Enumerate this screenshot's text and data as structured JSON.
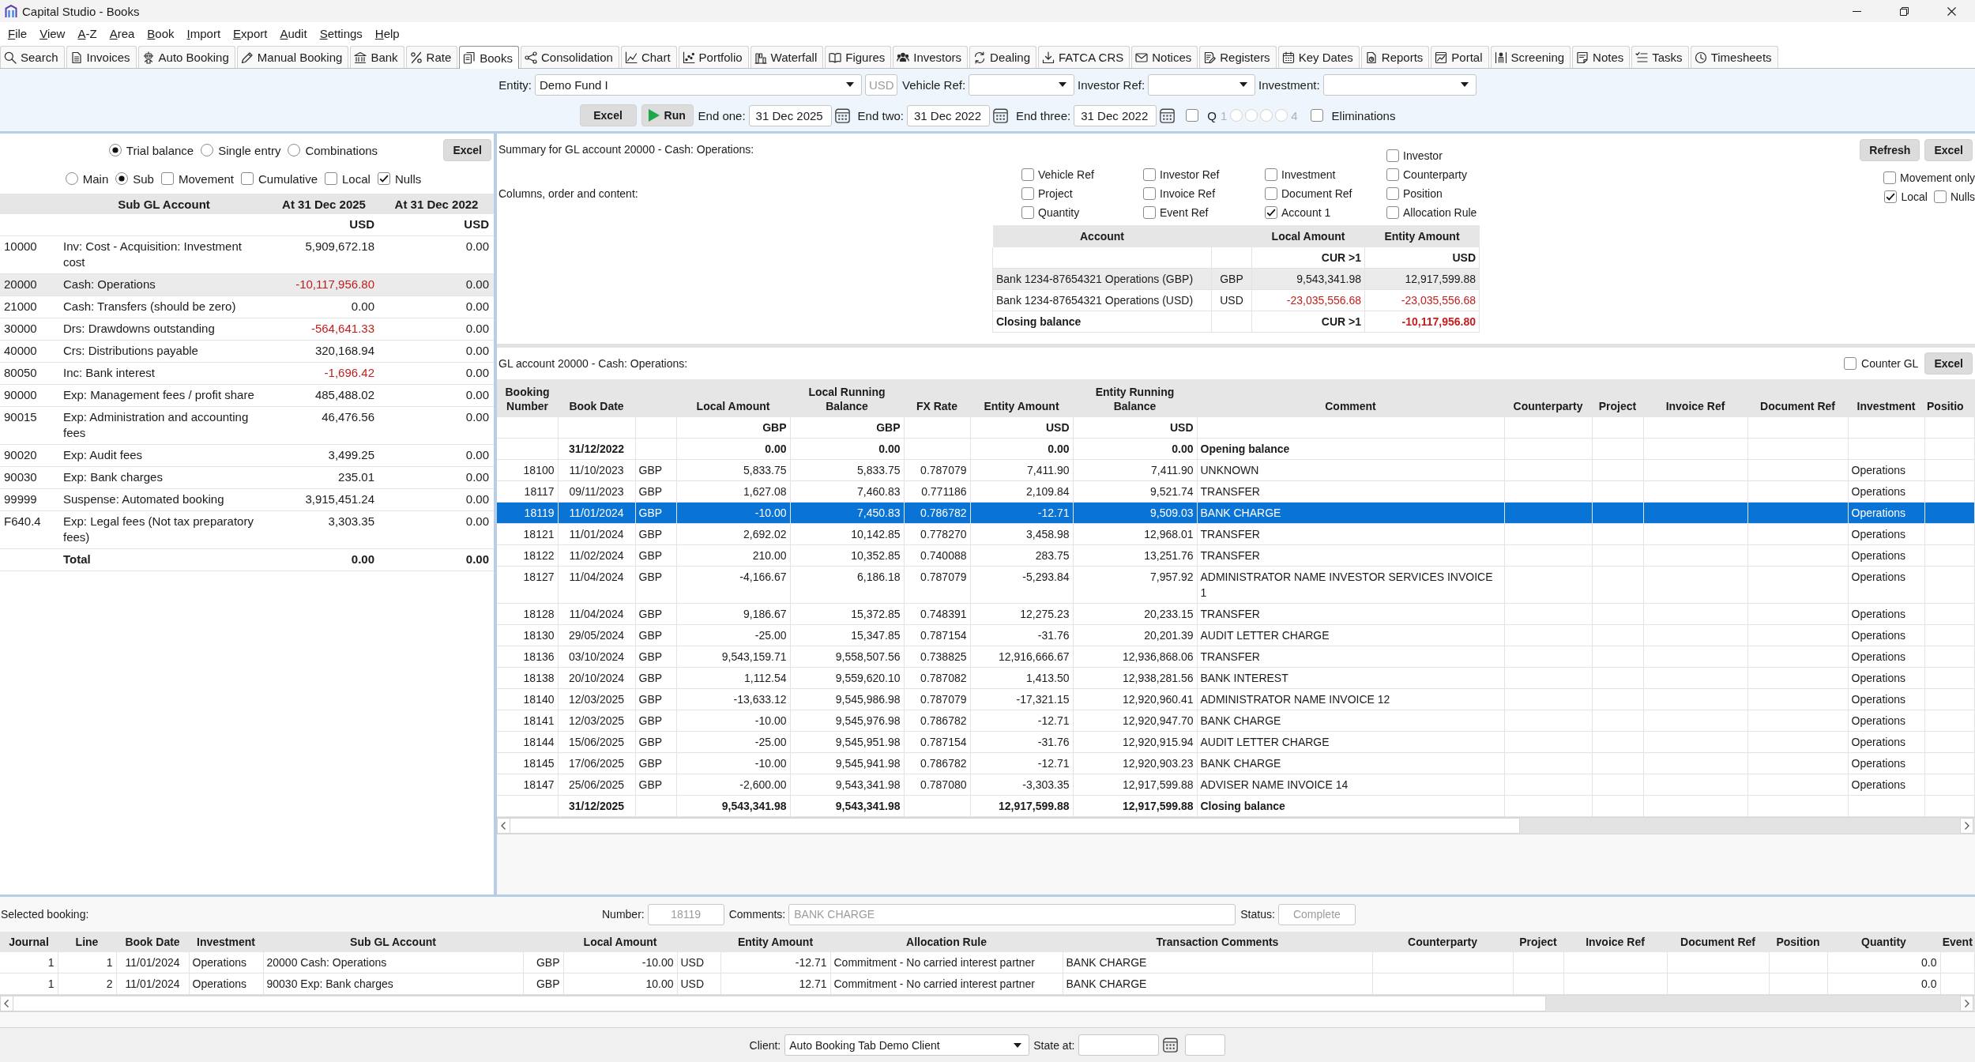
{
  "window": {
    "title": "Capital Studio - Books"
  },
  "menu": [
    "File",
    "View",
    "A-Z",
    "Area",
    "Book",
    "Import",
    "Export",
    "Audit",
    "Settings",
    "Help"
  ],
  "toolbar": [
    {
      "label": "Search",
      "selected": false
    },
    {
      "label": "Invoices",
      "selected": false
    },
    {
      "label": "Auto Booking",
      "selected": false
    },
    {
      "label": "Manual Booking",
      "selected": false
    },
    {
      "label": "Bank",
      "selected": false
    },
    {
      "label": "Rate",
      "selected": false
    },
    {
      "label": "Books",
      "selected": true
    },
    {
      "label": "Consolidation",
      "selected": false
    },
    {
      "label": "Chart",
      "selected": false
    },
    {
      "label": "Portfolio",
      "selected": false
    },
    {
      "label": "Waterfall",
      "selected": false
    },
    {
      "label": "Figures",
      "selected": false
    },
    {
      "label": "Investors",
      "selected": false
    },
    {
      "label": "Dealing",
      "selected": false
    },
    {
      "label": "FATCA CRS",
      "selected": false
    },
    {
      "label": "Notices",
      "selected": false
    },
    {
      "label": "Registers",
      "selected": false
    },
    {
      "label": "Key Dates",
      "selected": false
    },
    {
      "label": "Reports",
      "selected": false
    },
    {
      "label": "Portal",
      "selected": false
    },
    {
      "label": "Screening",
      "selected": false
    },
    {
      "label": "Notes",
      "selected": false
    },
    {
      "label": "Tasks",
      "selected": false
    },
    {
      "label": "Timesheets",
      "selected": false
    }
  ],
  "filters": {
    "entity": {
      "label": "Entity:",
      "value": "Demo Fund I"
    },
    "currency": {
      "value": "USD",
      "disabled": true
    },
    "vehicle_ref": {
      "label": "Vehicle Ref:"
    },
    "investor_ref": {
      "label": "Investor Ref:"
    },
    "investment": {
      "label": "Investment:"
    }
  },
  "run_bar": {
    "excel": "Excel",
    "run": "Run",
    "dates": [
      {
        "label": "End one:",
        "value": "31 Dec 2025"
      },
      {
        "label": "End two:",
        "value": "31 Dec 2022"
      },
      {
        "label": "End three:",
        "value": "31 Dec 2022"
      }
    ],
    "quarter": {
      "label": "Q",
      "checked": false,
      "disabled": true,
      "range_start": "1",
      "range_end": "4",
      "options": [
        {
          "selected": false
        },
        {
          "selected": false
        },
        {
          "selected": false
        },
        {
          "selected": false
        }
      ]
    },
    "eliminations": {
      "label": "Eliminations",
      "checked": false
    }
  },
  "trial_balance": {
    "modes": [
      {
        "label": "Trial balance",
        "selected": true
      },
      {
        "label": "Single entry",
        "selected": false
      },
      {
        "label": "Combinations",
        "selected": false
      }
    ],
    "excel": "Excel",
    "levels": [
      {
        "label": "Main",
        "selected": false
      },
      {
        "label": "Sub",
        "selected": true
      }
    ],
    "options": [
      {
        "label": "Movement",
        "checked": false
      },
      {
        "label": "Cumulative",
        "checked": false
      },
      {
        "label": "Local",
        "checked": false
      },
      {
        "label": "Nulls",
        "checked": true
      }
    ],
    "table": {
      "columns": {
        "account": "Sub GL Account",
        "end_one": "At 31 Dec 2025",
        "end_two": "At 31 Dec 2022"
      },
      "units": {
        "end_one": "USD",
        "end_two": "USD"
      },
      "rows": [
        {
          "code": "10000",
          "account": "Inv: Cost - Acquisition: Investment cost",
          "end_one": "5,909,672.18",
          "end_two": "0.00",
          "selected": false
        },
        {
          "code": "20000",
          "account": "Cash: Operations",
          "end_one": "-10,117,956.80",
          "end_two": "0.00",
          "selected": true
        },
        {
          "code": "21000",
          "account": "Cash: Transfers (should be zero)",
          "end_one": "0.00",
          "end_two": "0.00",
          "selected": false
        },
        {
          "code": "30000",
          "account": "Drs: Drawdowns outstanding",
          "end_one": "-564,641.33",
          "end_two": "0.00",
          "selected": false
        },
        {
          "code": "40000",
          "account": "Crs: Distributions payable",
          "end_one": "320,168.94",
          "end_two": "0.00",
          "selected": false
        },
        {
          "code": "80050",
          "account": "Inc: Bank interest",
          "end_one": "-1,696.42",
          "end_two": "0.00",
          "selected": false
        },
        {
          "code": "90000",
          "account": "Exp: Management fees / profit share",
          "end_one": "485,488.02",
          "end_two": "0.00",
          "selected": false
        },
        {
          "code": "90015",
          "account": "Exp: Administration and accounting fees",
          "end_one": "46,476.56",
          "end_two": "0.00",
          "selected": false
        },
        {
          "code": "90020",
          "account": "Exp: Audit fees",
          "end_one": "3,499.25",
          "end_two": "0.00",
          "selected": false
        },
        {
          "code": "90030",
          "account": "Exp: Bank charges",
          "end_one": "235.01",
          "end_two": "0.00",
          "selected": false
        },
        {
          "code": "99999",
          "account": "Suspense: Automated booking",
          "end_one": "3,915,451.24",
          "end_two": "0.00",
          "selected": false
        },
        {
          "code": "F640.4",
          "account": "Exp: Legal fees (Not tax preparatory fees)",
          "end_one": "3,303.35",
          "end_two": "0.00",
          "selected": false
        }
      ],
      "total": {
        "account": "Total",
        "end_one": "0.00",
        "end_two": "0.00"
      }
    }
  },
  "summary": {
    "title": "Summary for GL account 20000 - Cash: Operations:",
    "columns_label": "Columns, order and content:",
    "column_groups": [
      {
        "options": [
          {
            "label": "Vehicle Ref",
            "checked": false
          },
          {
            "label": "Project",
            "checked": false
          },
          {
            "label": "Quantity",
            "checked": false
          }
        ]
      },
      {
        "options": [
          {
            "label": "Investor Ref",
            "checked": false
          },
          {
            "label": "Invoice Ref",
            "checked": false
          },
          {
            "label": "Event Ref",
            "checked": false
          }
        ]
      },
      {
        "options": [
          {
            "label": "Investment",
            "checked": false
          },
          {
            "label": "Document Ref",
            "checked": false
          },
          {
            "label": "Account 1",
            "checked": true
          }
        ]
      },
      {
        "options": [
          {
            "label": "Investor",
            "checked": false
          },
          {
            "label": "Counterparty",
            "checked": false
          },
          {
            "label": "Position",
            "checked": false
          },
          {
            "label": "Allocation Rule",
            "checked": false
          }
        ]
      }
    ],
    "refresh": "Refresh",
    "excel": "Excel",
    "options": [
      {
        "label": "Movement only",
        "checked": false
      },
      {
        "label": "Local",
        "checked": true
      },
      {
        "label": "Nulls",
        "checked": false
      }
    ],
    "table": {
      "columns": {
        "account": "Account",
        "local_amount": "Local Amount",
        "entity_amount": "Entity Amount"
      },
      "units": {
        "local_amount": "CUR >1",
        "entity_amount": "USD"
      },
      "rows": [
        {
          "account": "Bank 1234-87654321 Operations (GBP)",
          "currency": "GBP",
          "local_amount": "9,543,341.98",
          "entity_amount": "12,917,599.88",
          "selected": true
        },
        {
          "account": "Bank 1234-87654321 Operations (USD)",
          "currency": "USD",
          "local_amount": "-23,035,556.68",
          "entity_amount": "-23,035,556.68",
          "selected": false
        }
      ],
      "closing": {
        "account": "Closing balance",
        "local_amount": "CUR >1",
        "entity_amount": "-10,117,956.80"
      }
    }
  },
  "gl_detail": {
    "title": "GL account 20000 - Cash: Operations:",
    "counter_gl": {
      "label": "Counter GL",
      "checked": false
    },
    "excel": "Excel",
    "table": {
      "columns": {
        "booking_number": "Booking Number",
        "book_date": "Book Date",
        "local_amount": "Local Amount",
        "local_running_balance": "Local Running Balance",
        "fx_rate": "FX Rate",
        "entity_amount": "Entity Amount",
        "entity_running_balance": "Entity Running Balance",
        "comment": "Comment",
        "counterparty": "Counterparty",
        "project": "Project",
        "invoice_ref": "Invoice Ref",
        "document_ref": "Document Ref",
        "investment": "Investment",
        "position": "Positio"
      },
      "units": {
        "local_amount": "GBP",
        "local_running_balance": "GBP",
        "entity_amount": "USD",
        "entity_running_balance": "USD"
      },
      "opening": {
        "book_date": "31/12/2022",
        "local_amount": "0.00",
        "local_running_balance": "0.00",
        "entity_amount": "0.00",
        "entity_running_balance": "0.00",
        "comment": "Opening balance"
      },
      "rows": [
        {
          "booking_number": "18100",
          "book_date": "11/10/2023",
          "currency": "GBP",
          "local_amount": "5,833.75",
          "local_running_balance": "5,833.75",
          "fx_rate": "0.787079",
          "entity_amount": "7,411.90",
          "entity_running_balance": "7,411.90",
          "comment": "UNKNOWN",
          "investment": "Operations",
          "selected": false
        },
        {
          "booking_number": "18117",
          "book_date": "09/11/2023",
          "currency": "GBP",
          "local_amount": "1,627.08",
          "local_running_balance": "7,460.83",
          "fx_rate": "0.771186",
          "entity_amount": "2,109.84",
          "entity_running_balance": "9,521.74",
          "comment": "TRANSFER",
          "investment": "Operations",
          "selected": false
        },
        {
          "booking_number": "18119",
          "book_date": "11/01/2024",
          "currency": "GBP",
          "local_amount": "-10.00",
          "local_running_balance": "7,450.83",
          "fx_rate": "0.786782",
          "entity_amount": "-12.71",
          "entity_running_balance": "9,509.03",
          "comment": "BANK CHARGE",
          "investment": "Operations",
          "selected": true
        },
        {
          "booking_number": "18121",
          "book_date": "11/01/2024",
          "currency": "GBP",
          "local_amount": "2,692.02",
          "local_running_balance": "10,142.85",
          "fx_rate": "0.778270",
          "entity_amount": "3,458.98",
          "entity_running_balance": "12,968.01",
          "comment": "TRANSFER",
          "investment": "Operations",
          "selected": false
        },
        {
          "booking_number": "18122",
          "book_date": "11/02/2024",
          "currency": "GBP",
          "local_amount": "210.00",
          "local_running_balance": "10,352.85",
          "fx_rate": "0.740088",
          "entity_amount": "283.75",
          "entity_running_balance": "13,251.76",
          "comment": "TRANSFER",
          "investment": "Operations",
          "selected": false
        },
        {
          "booking_number": "18127",
          "book_date": "11/04/2024",
          "currency": "GBP",
          "local_amount": "-4,166.67",
          "local_running_balance": "6,186.18",
          "fx_rate": "0.787079",
          "entity_amount": "-5,293.84",
          "entity_running_balance": "7,957.92",
          "comment": "ADMINISTRATOR NAME INVESTOR SERVICES INVOICE 1",
          "investment": "Operations",
          "selected": false
        },
        {
          "booking_number": "18128",
          "book_date": "11/04/2024",
          "currency": "GBP",
          "local_amount": "9,186.67",
          "local_running_balance": "15,372.85",
          "fx_rate": "0.748391",
          "entity_amount": "12,275.23",
          "entity_running_balance": "20,233.15",
          "comment": "TRANSFER",
          "investment": "Operations",
          "selected": false
        },
        {
          "booking_number": "18130",
          "book_date": "29/05/2024",
          "currency": "GBP",
          "local_amount": "-25.00",
          "local_running_balance": "15,347.85",
          "fx_rate": "0.787154",
          "entity_amount": "-31.76",
          "entity_running_balance": "20,201.39",
          "comment": "AUDIT LETTER CHARGE",
          "investment": "Operations",
          "selected": false
        },
        {
          "booking_number": "18136",
          "book_date": "03/10/2024",
          "currency": "GBP",
          "local_amount": "9,543,159.71",
          "local_running_balance": "9,558,507.56",
          "fx_rate": "0.738825",
          "entity_amount": "12,916,666.67",
          "entity_running_balance": "12,936,868.06",
          "comment": "TRANSFER",
          "investment": "Operations",
          "selected": false
        },
        {
          "booking_number": "18138",
          "book_date": "20/10/2024",
          "currency": "GBP",
          "local_amount": "1,112.54",
          "local_running_balance": "9,559,620.10",
          "fx_rate": "0.787082",
          "entity_amount": "1,413.50",
          "entity_running_balance": "12,938,281.56",
          "comment": "BANK INTEREST",
          "investment": "Operations",
          "selected": false
        },
        {
          "booking_number": "18140",
          "book_date": "12/03/2025",
          "currency": "GBP",
          "local_amount": "-13,633.12",
          "local_running_balance": "9,545,986.98",
          "fx_rate": "0.787079",
          "entity_amount": "-17,321.15",
          "entity_running_balance": "12,920,960.41",
          "comment": "ADMINISTRATOR NAME INVOICE 12",
          "investment": "Operations",
          "selected": false
        },
        {
          "booking_number": "18141",
          "book_date": "12/03/2025",
          "currency": "GBP",
          "local_amount": "-10.00",
          "local_running_balance": "9,545,976.98",
          "fx_rate": "0.786782",
          "entity_amount": "-12.71",
          "entity_running_balance": "12,920,947.70",
          "comment": "BANK CHARGE",
          "investment": "Operations",
          "selected": false
        },
        {
          "booking_number": "18144",
          "book_date": "15/06/2025",
          "currency": "GBP",
          "local_amount": "-25.00",
          "local_running_balance": "9,545,951.98",
          "fx_rate": "0.787154",
          "entity_amount": "-31.76",
          "entity_running_balance": "12,920,915.94",
          "comment": "AUDIT LETTER CHARGE",
          "investment": "Operations",
          "selected": false
        },
        {
          "booking_number": "18145",
          "book_date": "17/06/2025",
          "currency": "GBP",
          "local_amount": "-10.00",
          "local_running_balance": "9,545,941.98",
          "fx_rate": "0.786782",
          "entity_amount": "-12.71",
          "entity_running_balance": "12,920,903.23",
          "comment": "BANK CHARGE",
          "investment": "Operations",
          "selected": false
        },
        {
          "booking_number": "18147",
          "book_date": "25/06/2025",
          "currency": "GBP",
          "local_amount": "-2,600.00",
          "local_running_balance": "9,543,341.98",
          "fx_rate": "0.787080",
          "entity_amount": "-3,303.35",
          "entity_running_balance": "12,917,599.88",
          "comment": "ADVISER NAME INVOICE 14",
          "investment": "Operations",
          "selected": false
        }
      ],
      "closing": {
        "book_date": "31/12/2025",
        "local_amount": "9,543,341.98",
        "local_running_balance": "9,543,341.98",
        "entity_amount": "12,917,599.88",
        "entity_running_balance": "12,917,599.88",
        "comment": "Closing balance"
      }
    }
  },
  "selected_booking": {
    "label": "Selected booking:",
    "number": {
      "label": "Number:",
      "value": "18119",
      "disabled": true
    },
    "comments": {
      "label": "Comments:",
      "value": "BANK CHARGE",
      "disabled": true
    },
    "status": {
      "label": "Status:",
      "value": "Complete",
      "disabled": true
    },
    "table": {
      "columns": {
        "journal": "Journal",
        "line": "Line",
        "book_date": "Book Date",
        "investment": "Investment",
        "sub_gl_account": "Sub GL Account",
        "local_amount": "Local Amount",
        "entity_amount": "Entity Amount",
        "allocation_rule": "Allocation Rule",
        "transaction_comments": "Transaction Comments",
        "counterparty": "Counterparty",
        "project": "Project",
        "invoice_ref": "Invoice Ref",
        "document_ref": "Document Ref",
        "position": "Position",
        "quantity": "Quantity",
        "event": "Event"
      },
      "rows": [
        {
          "journal": "1",
          "line": "1",
          "book_date": "11/01/2024",
          "investment": "Operations",
          "sub_gl_account": "20000 Cash: Operations",
          "local_currency": "GBP",
          "local_amount": "-10.00",
          "entity_currency": "USD",
          "entity_amount": "-12.71",
          "allocation_rule": "Commitment - No carried interest partner",
          "transaction_comments": "BANK CHARGE",
          "quantity": "0.0"
        },
        {
          "journal": "1",
          "line": "2",
          "book_date": "11/01/2024",
          "investment": "Operations",
          "sub_gl_account": "90030 Exp: Bank charges",
          "local_currency": "GBP",
          "local_amount": "10.00",
          "entity_currency": "USD",
          "entity_amount": "12.71",
          "allocation_rule": "Commitment - No carried interest partner",
          "transaction_comments": "BANK CHARGE",
          "quantity": "0.0"
        }
      ]
    }
  },
  "status_bar": {
    "client": {
      "label": "Client:",
      "value": "Auto Booking Tab Demo Client"
    },
    "state_at": {
      "label": "State at:"
    }
  }
}
